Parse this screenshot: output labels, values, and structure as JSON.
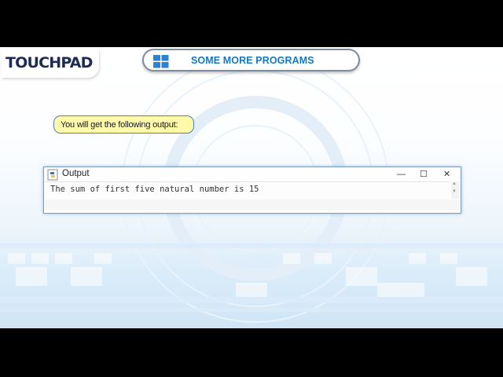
{
  "logo": {
    "text_touch": "TOUCH",
    "text_pad": "PAD"
  },
  "header": {
    "title": "SOME MORE PROGRAMS",
    "icon": "windows-logo-icon"
  },
  "callout": {
    "text": "You will get the following output:"
  },
  "output_window": {
    "title": "Output",
    "icon": "python-icon",
    "minimize": "—",
    "maximize": "☐",
    "close": "✕",
    "line": "The sum of first five natural number is 15",
    "scroll_up": "▲",
    "scroll_down": "▼"
  },
  "colors": {
    "accent": "#1378c4",
    "logo_blue": "#2c9ad6",
    "callout_fill": "#fffaa9",
    "navy": "#1d2c56"
  }
}
